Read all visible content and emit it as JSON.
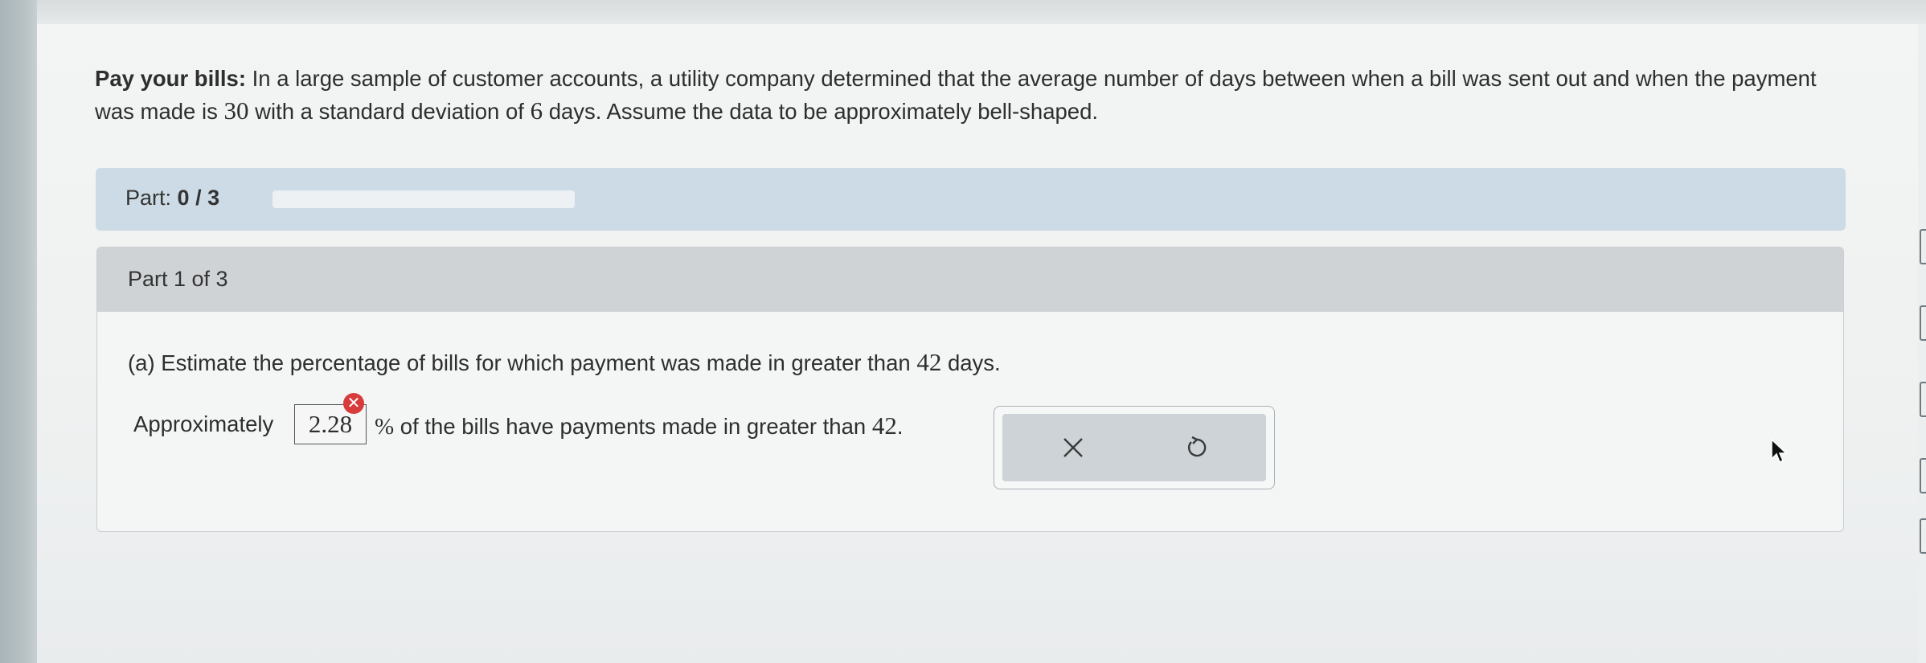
{
  "problem": {
    "title": "Pay your bills:",
    "text_part1": " In a large sample of customer accounts, a utility company determined that the average number of days between when a bill was sent out and when the payment was made is ",
    "mean": "30",
    "text_part2": " with a standard deviation of ",
    "sd": "6",
    "text_part3": " days. Assume the data to be approximately bell-shaped."
  },
  "progress": {
    "label": "Part:",
    "value": "0 / 3",
    "fraction": 0
  },
  "part": {
    "header": "Part 1 of 3",
    "question_prefix": "(a) Estimate the percentage of bills for which payment was made in greater than ",
    "question_value": "42",
    "question_suffix": " days.",
    "answer_prefix": "Approximately",
    "answer_value": "2.28",
    "answer_suffix": "% of the bills have payments made in greater than 42.",
    "answer_status": "incorrect"
  },
  "actions": {
    "clear_icon": "×",
    "undo_icon": "↺"
  },
  "colors": {
    "progress_bar_bg": "#ccdbe5",
    "part_header_bg": "#cfd3d6",
    "error": "#d83b3b"
  }
}
